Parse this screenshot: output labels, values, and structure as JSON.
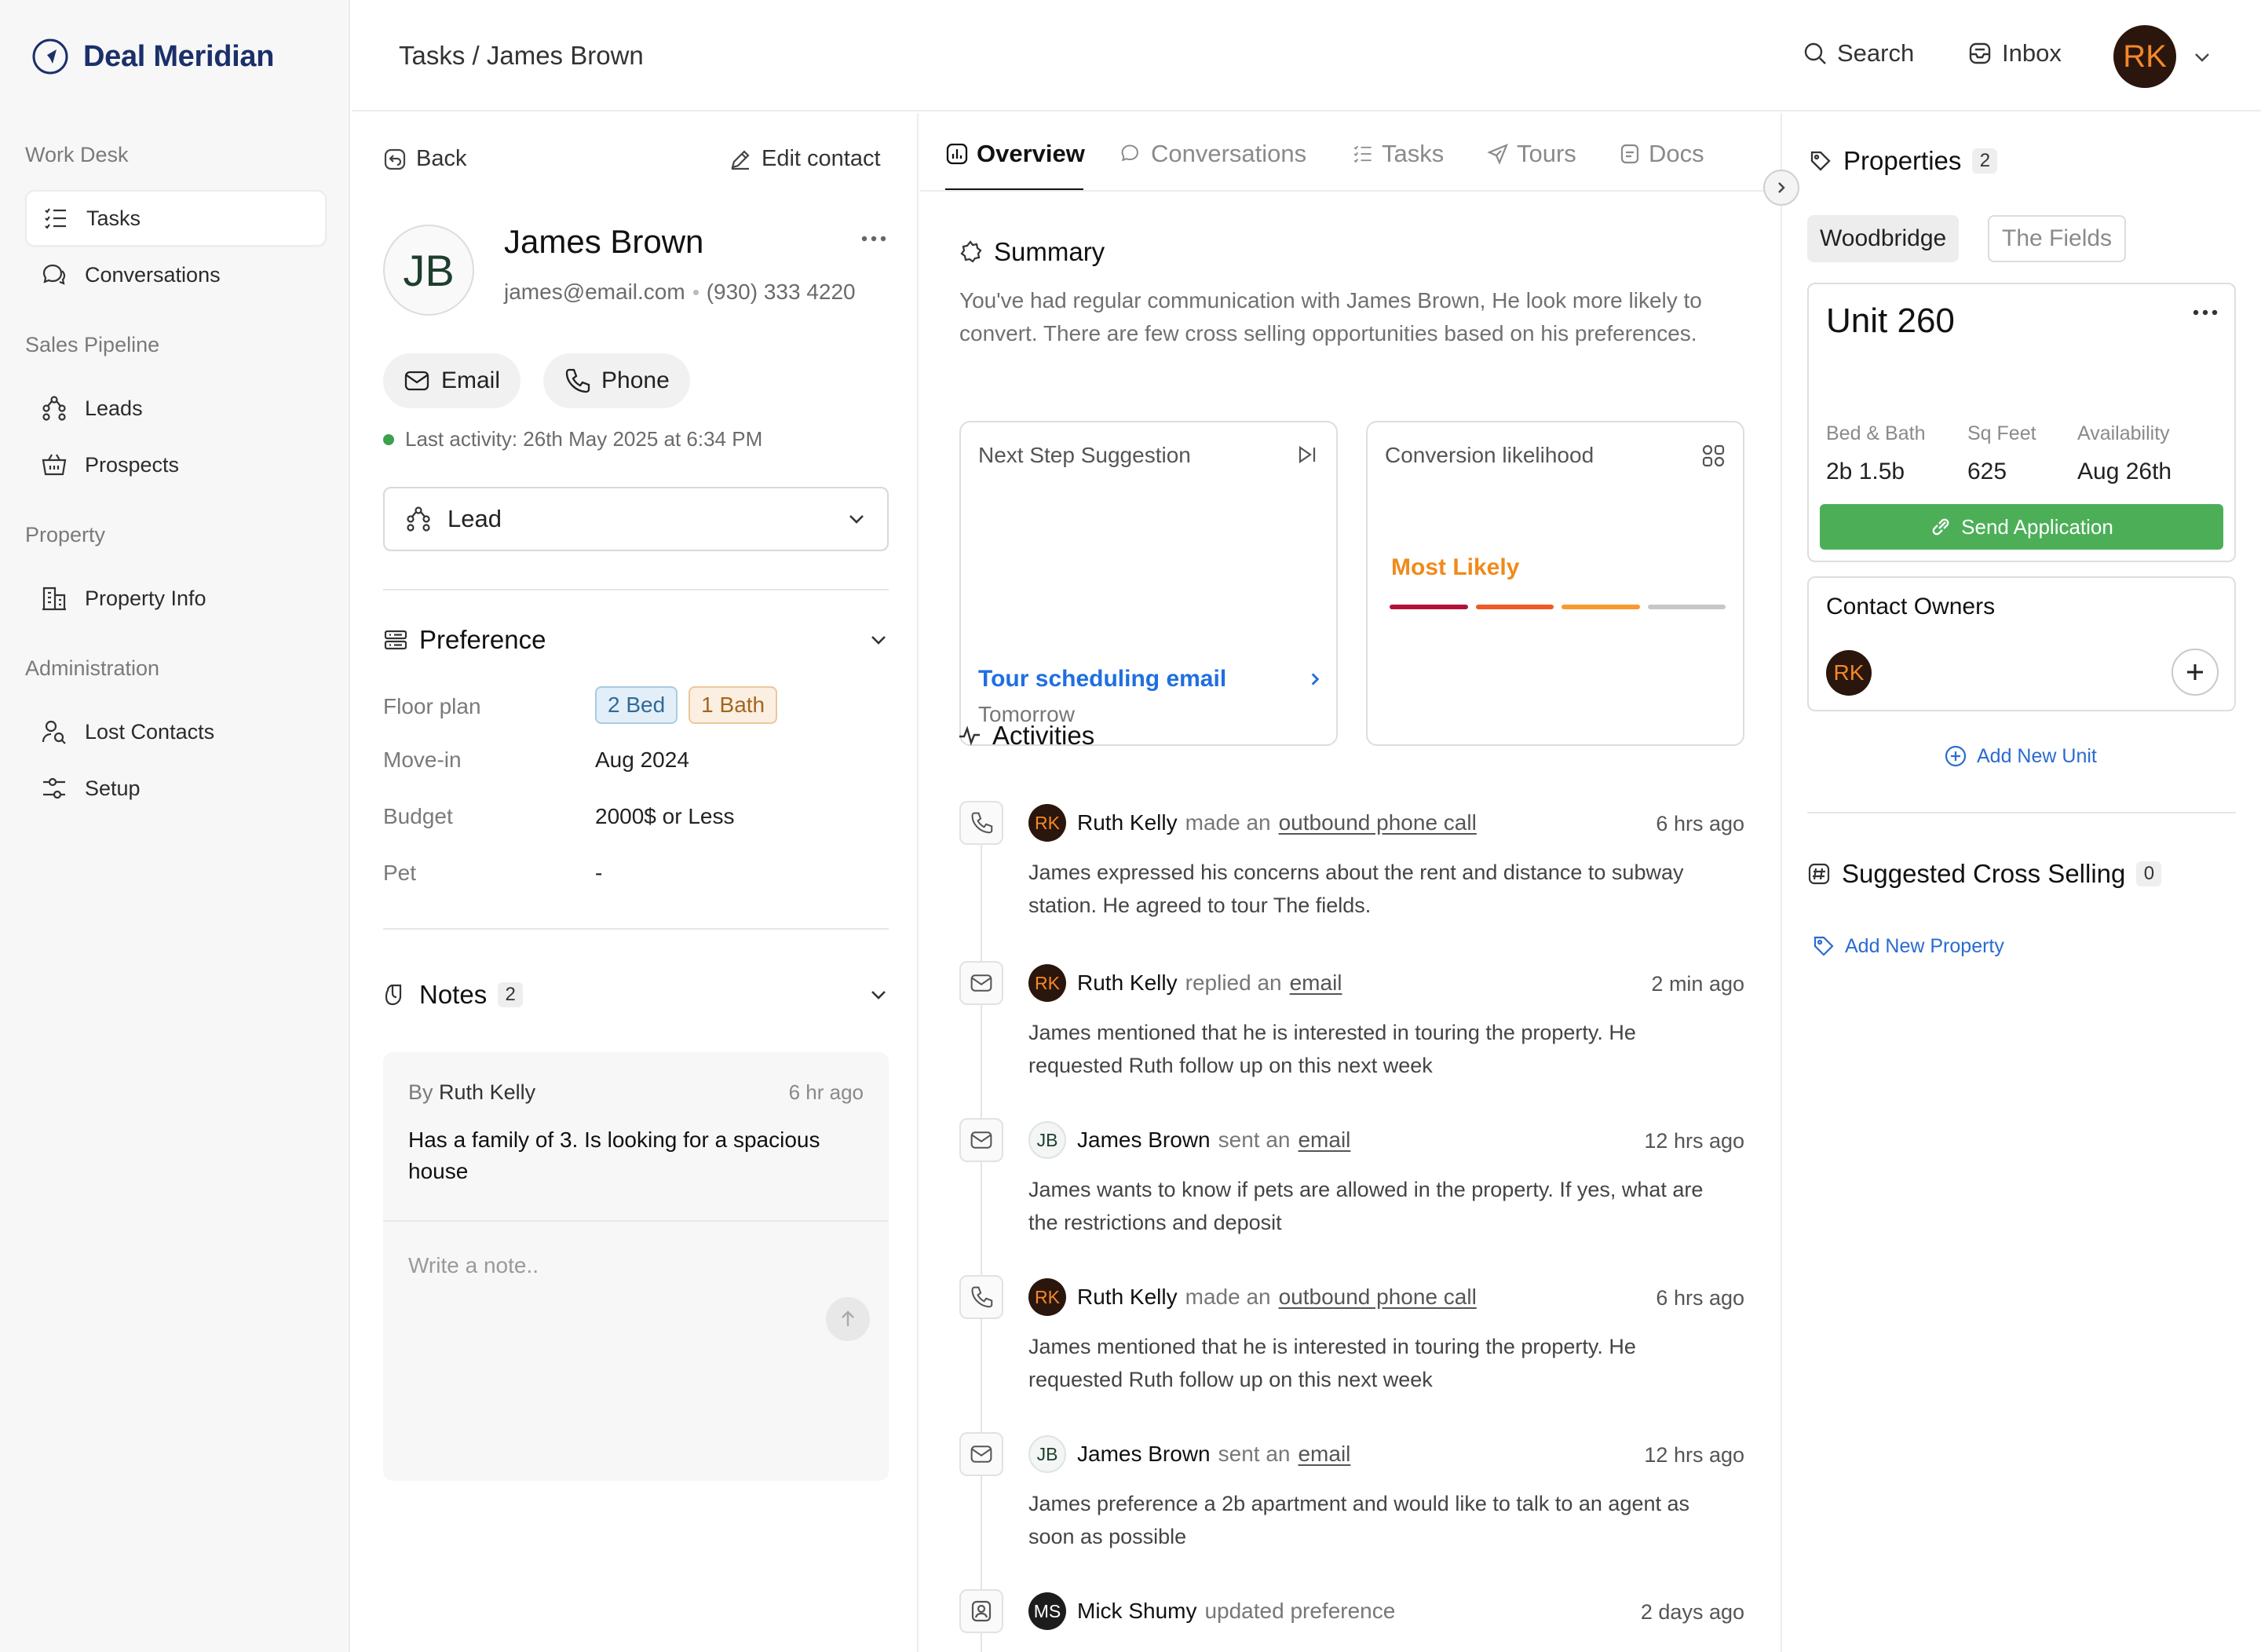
{
  "app": {
    "name": "Deal Meridian"
  },
  "sidebar": {
    "sections": [
      {
        "title": "Work Desk",
        "items": [
          {
            "label": "Tasks",
            "icon": "list-check-icon",
            "active": true
          },
          {
            "label": "Conversations",
            "icon": "chat-bubbles-icon"
          }
        ]
      },
      {
        "title": "Sales Pipeline",
        "items": [
          {
            "label": "Leads",
            "icon": "hierarchy-icon"
          },
          {
            "label": "Prospects",
            "icon": "basket-icon"
          }
        ]
      },
      {
        "title": "Property",
        "items": [
          {
            "label": "Property Info",
            "icon": "building-icon"
          }
        ]
      },
      {
        "title": "Administration",
        "items": [
          {
            "label": "Lost Contacts",
            "icon": "user-search-icon"
          },
          {
            "label": "Setup",
            "icon": "sliders-icon"
          }
        ]
      }
    ]
  },
  "topbar": {
    "breadcrumb": "Tasks / James Brown",
    "search_label": "Search",
    "inbox_label": "Inbox",
    "user_initials": "RK"
  },
  "contact": {
    "back_label": "Back",
    "edit_label": "Edit contact",
    "initials": "JB",
    "name": "James Brown",
    "email": "james@email.com",
    "phone": "(930) 333 4220",
    "email_btn": "Email",
    "phone_btn": "Phone",
    "last_activity": "Last activity: 26th May 2025 at 6:34 PM",
    "stage": "Lead",
    "preference": {
      "title": "Preference",
      "rows": [
        {
          "label": "Floor plan",
          "tags": [
            "2 Bed",
            "1 Bath"
          ]
        },
        {
          "label": "Move-in",
          "value": "Aug 2024"
        },
        {
          "label": "Budget",
          "value": "2000$ or Less"
        },
        {
          "label": "Pet",
          "value": "-"
        }
      ]
    },
    "notes": {
      "title": "Notes",
      "count": "2",
      "items": [
        {
          "by_prefix": "By",
          "author": "Ruth Kelly",
          "time": "6 hr ago",
          "text": "Has a family of 3. Is looking for a spacious house"
        }
      ],
      "placeholder": "Write a note.."
    }
  },
  "main": {
    "tabs": [
      {
        "label": "Overview",
        "icon": "chart-icon",
        "active": true
      },
      {
        "label": "Conversations",
        "icon": "chat-bubbles-icon"
      },
      {
        "label": "Tasks",
        "icon": "list-check-icon"
      },
      {
        "label": "Tours",
        "icon": "send-icon"
      },
      {
        "label": "Docs",
        "icon": "document-icon"
      }
    ],
    "summary": {
      "title": "Summary",
      "text": "You've had regular communication with James Brown, He look more likely to convert. There are few cross selling opportunities based on his preferences."
    },
    "next_step": {
      "title": "Next Step Suggestion",
      "action": "Tour scheduling email",
      "when": "Tomorrow"
    },
    "conversion": {
      "title": "Conversion likelihood",
      "value": "Most Likely",
      "level": 3,
      "segments": 4,
      "segment_colors": [
        "#b3133a",
        "#ef5a24",
        "#f79a2e",
        "#c7c7c7"
      ]
    },
    "activities_title": "Activities",
    "activities": [
      {
        "icon": "phone-icon",
        "avatar": "RK",
        "avatar_type": "rk",
        "actor": "Ruth Kelly",
        "verb": "made an",
        "object": "outbound phone call",
        "time": "6 hrs ago",
        "body": "James expressed his concerns about the rent and distance to subway station. He agreed to tour The fields."
      },
      {
        "icon": "mail-icon",
        "avatar": "RK",
        "avatar_type": "rk",
        "actor": "Ruth Kelly",
        "verb": "replied an",
        "object": "email",
        "time": "2 min ago",
        "body": "James mentioned that he is interested in touring the property. He requested Ruth follow up on this next week"
      },
      {
        "icon": "mail-icon",
        "avatar": "JB",
        "avatar_type": "jb",
        "actor": "James Brown",
        "verb": "sent an",
        "object": "email",
        "time": "12 hrs ago",
        "body": "James wants to know if pets are allowed in the property. If yes, what are the restrictions and deposit"
      },
      {
        "icon": "phone-icon",
        "avatar": "RK",
        "avatar_type": "rk",
        "actor": "Ruth Kelly",
        "verb": "made an",
        "object": "outbound phone call",
        "time": "6 hrs ago",
        "body": "James mentioned that he is interested in touring the property. He requested Ruth follow up on this next week"
      },
      {
        "icon": "mail-icon",
        "avatar": "JB",
        "avatar_type": "jb",
        "actor": "James Brown",
        "verb": "sent an",
        "object": "email",
        "time": "12 hrs ago",
        "body": "James preference a 2b apartment and would like to talk to an agent as soon as possible"
      },
      {
        "icon": "user-badge-icon",
        "avatar": "MS",
        "avatar_type": "ms",
        "actor": "Mick Shumy",
        "verb": "updated preference",
        "object": "",
        "time": "2 days ago",
        "body": ""
      }
    ]
  },
  "properties": {
    "title": "Properties",
    "count": "2",
    "chips": [
      {
        "label": "Woodbridge",
        "active": true
      },
      {
        "label": "The Fields",
        "active": false
      }
    ],
    "unit": {
      "name": "Unit 260",
      "specs": [
        {
          "label": "Bed & Bath",
          "value": "2b 1.5b"
        },
        {
          "label": "Sq Feet",
          "value": "625"
        },
        {
          "label": "Availability",
          "value": "Aug 26th"
        }
      ],
      "cta": "Send Application"
    },
    "owners": {
      "title": "Contact Owners",
      "initials": "RK"
    },
    "add_unit": "Add New Unit",
    "cross_selling": {
      "title": "Suggested Cross Selling",
      "count": "0",
      "add_label": "Add New Property"
    }
  }
}
